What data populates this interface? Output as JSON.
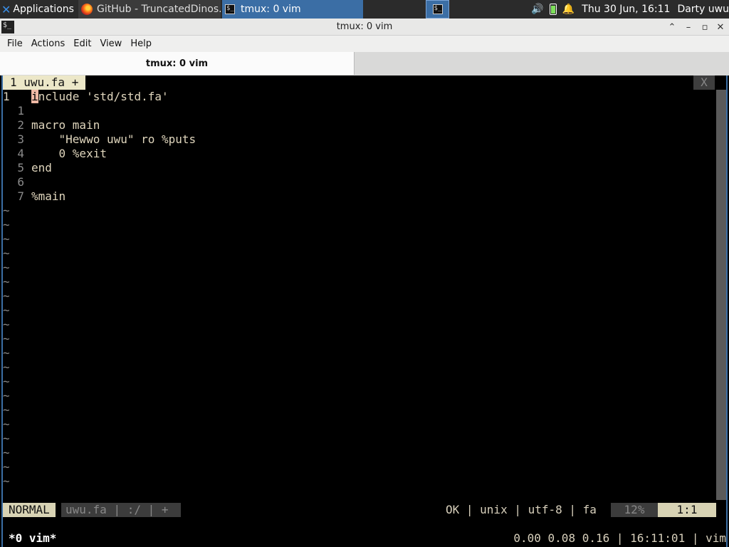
{
  "panel": {
    "applications_label": "Applications",
    "tasks": [
      {
        "label": "GitHub - TruncatedDinos...",
        "icon": "firefox-icon"
      },
      {
        "label": "tmux: 0 vim",
        "icon": "terminal-icon"
      }
    ],
    "clock": "Thu 30 Jun, 16:11",
    "user": "Darty uwu"
  },
  "window": {
    "title": "tmux: 0 vim",
    "buttons": {
      "up": "⌃",
      "minimize": "–",
      "maximize": "▫",
      "close": "✕"
    }
  },
  "menubar": {
    "items": [
      "File",
      "Actions",
      "Edit",
      "View",
      "Help"
    ]
  },
  "terminal_tab": {
    "label": "tmux: 0 vim"
  },
  "vim": {
    "tab_label": "1 uwu.fa +",
    "close_label": "X",
    "lines": [
      {
        "num": "1",
        "text": "include 'std/std.fa'"
      },
      {
        "num": "1",
        "text": ""
      },
      {
        "num": "2",
        "text": "macro main"
      },
      {
        "num": "3",
        "text": "    \"Hewwo uwu\" ro %puts"
      },
      {
        "num": "4",
        "text": "    0 %exit"
      },
      {
        "num": "5",
        "text": "end"
      },
      {
        "num": "6",
        "text": ""
      },
      {
        "num": "7",
        "text": "%main"
      }
    ],
    "tilde": "~",
    "tilde_count": 20,
    "status": {
      "mode": "NORMAL",
      "file": "uwu.fa",
      "sep1": "|",
      "dir": ":/",
      "sep2": "|",
      "modified": "+",
      "right": "OK | unix | utf-8 | fa",
      "percent": "12%",
      "position": "1:1"
    }
  },
  "tmux": {
    "window": "*0 vim*",
    "right": "0.00 0.08 0.16 | 16:11:01 | vim"
  }
}
